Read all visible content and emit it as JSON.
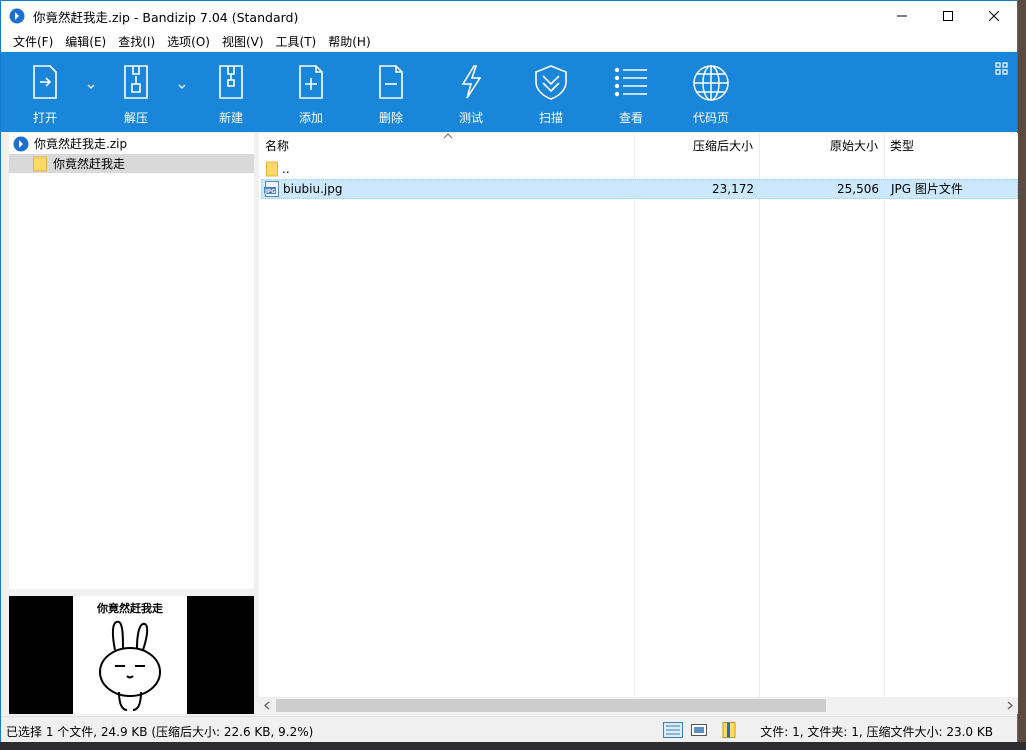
{
  "window": {
    "title": "你竟然赶我走.zip - Bandizip 7.04 (Standard)"
  },
  "menu": [
    "文件(F)",
    "编辑(E)",
    "查找(I)",
    "选项(O)",
    "视图(V)",
    "工具(T)",
    "帮助(H)"
  ],
  "toolbar": {
    "open": "打开",
    "extract": "解压",
    "new": "新建",
    "add": "添加",
    "delete": "删除",
    "test": "测试",
    "scan": "扫描",
    "view": "查看",
    "codepage": "代码页"
  },
  "tree": {
    "archive": "你竟然赶我走.zip",
    "folder": "你竟然赶我走"
  },
  "preview": {
    "caption": "你竟然赶我走"
  },
  "columns": {
    "name": "名称",
    "packed": "压缩后大小",
    "original": "原始大小",
    "type": "类型"
  },
  "files": [
    {
      "name": "..",
      "packed": "",
      "original": "",
      "type": ""
    },
    {
      "name": "biubiu.jpg",
      "packed": "23,172",
      "original": "25,506",
      "type": "JPG 图片文件"
    }
  ],
  "status": {
    "left": "已选择 1 个文件, 24.9 KB (压缩后大小: 22.6 KB, 9.2%)",
    "right": "文件: 1, 文件夹: 1, 压缩文件大小: 23.0 KB"
  },
  "colors": {
    "toolbar": "#1a86d9",
    "selection": "#cce8ff"
  },
  "icons": [
    "app-icon",
    "minimize-icon",
    "maximize-icon",
    "close-icon",
    "open-icon",
    "extract-icon",
    "new-archive-icon",
    "add-icon",
    "delete-icon",
    "test-icon",
    "scan-icon",
    "view-icon",
    "codepage-icon",
    "settings-icon",
    "zip-icon",
    "folder-icon",
    "jpg-icon",
    "details-view-icon",
    "preview-toggle-icon",
    "archive-status-icon"
  ]
}
